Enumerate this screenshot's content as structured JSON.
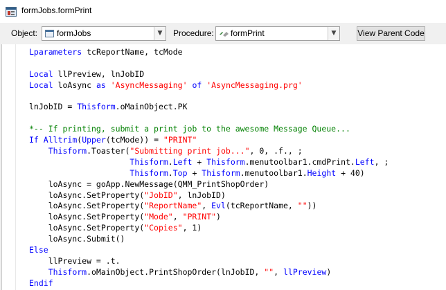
{
  "window": {
    "title": "formJobs.formPrint"
  },
  "toolbar": {
    "object_label": "Object:",
    "object_value": "formJobs",
    "procedure_label": "Procedure:",
    "procedure_value": "formPrint",
    "view_parent_label": "View Parent Code"
  },
  "code_lines": [
    [
      {
        "t": "kw",
        "v": "Lparameters"
      },
      {
        "t": "",
        "v": " tcReportName, tcMode"
      }
    ],
    [],
    [
      {
        "t": "kw",
        "v": "Local"
      },
      {
        "t": "",
        "v": " llPreview, lnJobID"
      }
    ],
    [
      {
        "t": "kw",
        "v": "Local"
      },
      {
        "t": "",
        "v": " loAsync "
      },
      {
        "t": "kw",
        "v": "as"
      },
      {
        "t": "",
        "v": " "
      },
      {
        "t": "str",
        "v": "'AsyncMessaging'"
      },
      {
        "t": "",
        "v": " "
      },
      {
        "t": "kw",
        "v": "of"
      },
      {
        "t": "",
        "v": " "
      },
      {
        "t": "str",
        "v": "'AsyncMessaging.prg'"
      }
    ],
    [],
    [
      {
        "t": "",
        "v": "lnJobID = "
      },
      {
        "t": "kw",
        "v": "Thisform"
      },
      {
        "t": "",
        "v": ".oMainObject.PK"
      }
    ],
    [],
    [
      {
        "t": "cm",
        "v": "*-- If printing, submit a print job to the awesome Message Queue..."
      }
    ],
    [
      {
        "t": "kw",
        "v": "If"
      },
      {
        "t": "",
        "v": " "
      },
      {
        "t": "kw",
        "v": "Alltrim"
      },
      {
        "t": "",
        "v": "("
      },
      {
        "t": "kw",
        "v": "Upper"
      },
      {
        "t": "",
        "v": "(tcMode)) = "
      },
      {
        "t": "str",
        "v": "\"PRINT\""
      }
    ],
    [
      {
        "t": "",
        "v": "    "
      },
      {
        "t": "kw",
        "v": "Thisform"
      },
      {
        "t": "",
        "v": ".Toaster("
      },
      {
        "t": "str",
        "v": "\"Submitting print job...\""
      },
      {
        "t": "",
        "v": ", 0, .f., ;"
      }
    ],
    [
      {
        "t": "",
        "v": "                     "
      },
      {
        "t": "kw",
        "v": "Thisform"
      },
      {
        "t": "",
        "v": "."
      },
      {
        "t": "kw",
        "v": "Left"
      },
      {
        "t": "",
        "v": " + "
      },
      {
        "t": "kw",
        "v": "Thisform"
      },
      {
        "t": "",
        "v": ".menutoolbar1.cmdPrint."
      },
      {
        "t": "kw",
        "v": "Left"
      },
      {
        "t": "",
        "v": ", ;"
      }
    ],
    [
      {
        "t": "",
        "v": "                     "
      },
      {
        "t": "kw",
        "v": "Thisform"
      },
      {
        "t": "",
        "v": "."
      },
      {
        "t": "kw",
        "v": "Top"
      },
      {
        "t": "",
        "v": " + "
      },
      {
        "t": "kw",
        "v": "Thisform"
      },
      {
        "t": "",
        "v": ".menutoolbar1."
      },
      {
        "t": "kw",
        "v": "Height"
      },
      {
        "t": "",
        "v": " + 40)"
      }
    ],
    [
      {
        "t": "",
        "v": "    loAsync = goApp.NewMessage(QMM_PrintShopOrder)"
      }
    ],
    [
      {
        "t": "",
        "v": "    loAsync.SetProperty("
      },
      {
        "t": "str",
        "v": "\"JobID\""
      },
      {
        "t": "",
        "v": ", lnJobID)"
      }
    ],
    [
      {
        "t": "",
        "v": "    loAsync.SetProperty("
      },
      {
        "t": "str",
        "v": "\"ReportName\""
      },
      {
        "t": "",
        "v": ", "
      },
      {
        "t": "kw",
        "v": "Evl"
      },
      {
        "t": "",
        "v": "(tcReportName, "
      },
      {
        "t": "str",
        "v": "\"\""
      },
      {
        "t": "",
        "v": "))"
      }
    ],
    [
      {
        "t": "",
        "v": "    loAsync.SetProperty("
      },
      {
        "t": "str",
        "v": "\"Mode\""
      },
      {
        "t": "",
        "v": ", "
      },
      {
        "t": "str",
        "v": "\"PRINT\""
      },
      {
        "t": "",
        "v": ")"
      }
    ],
    [
      {
        "t": "",
        "v": "    loAsync.SetProperty("
      },
      {
        "t": "str",
        "v": "\"Copies\""
      },
      {
        "t": "",
        "v": ", 1)"
      }
    ],
    [
      {
        "t": "",
        "v": "    loAsync.Submit()"
      }
    ],
    [
      {
        "t": "kw",
        "v": "Else"
      }
    ],
    [
      {
        "t": "",
        "v": "    llPreview = .t."
      }
    ],
    [
      {
        "t": "",
        "v": "    "
      },
      {
        "t": "kw",
        "v": "Thisform"
      },
      {
        "t": "",
        "v": ".oMainObject.PrintShopOrder(lnJobID, "
      },
      {
        "t": "str",
        "v": "\"\""
      },
      {
        "t": "",
        "v": ", "
      },
      {
        "t": "kw",
        "v": "llPreview"
      },
      {
        "t": "",
        "v": ")"
      }
    ],
    [
      {
        "t": "kw",
        "v": "Endif"
      }
    ]
  ],
  "icons": {
    "title": "form-window-icon",
    "object": "form-icon",
    "procedure": "method-icon",
    "dropdown": "chevron-down-icon"
  },
  "colors": {
    "keyword": "#0000ff",
    "string": "#ff0000",
    "comment": "#008000"
  }
}
